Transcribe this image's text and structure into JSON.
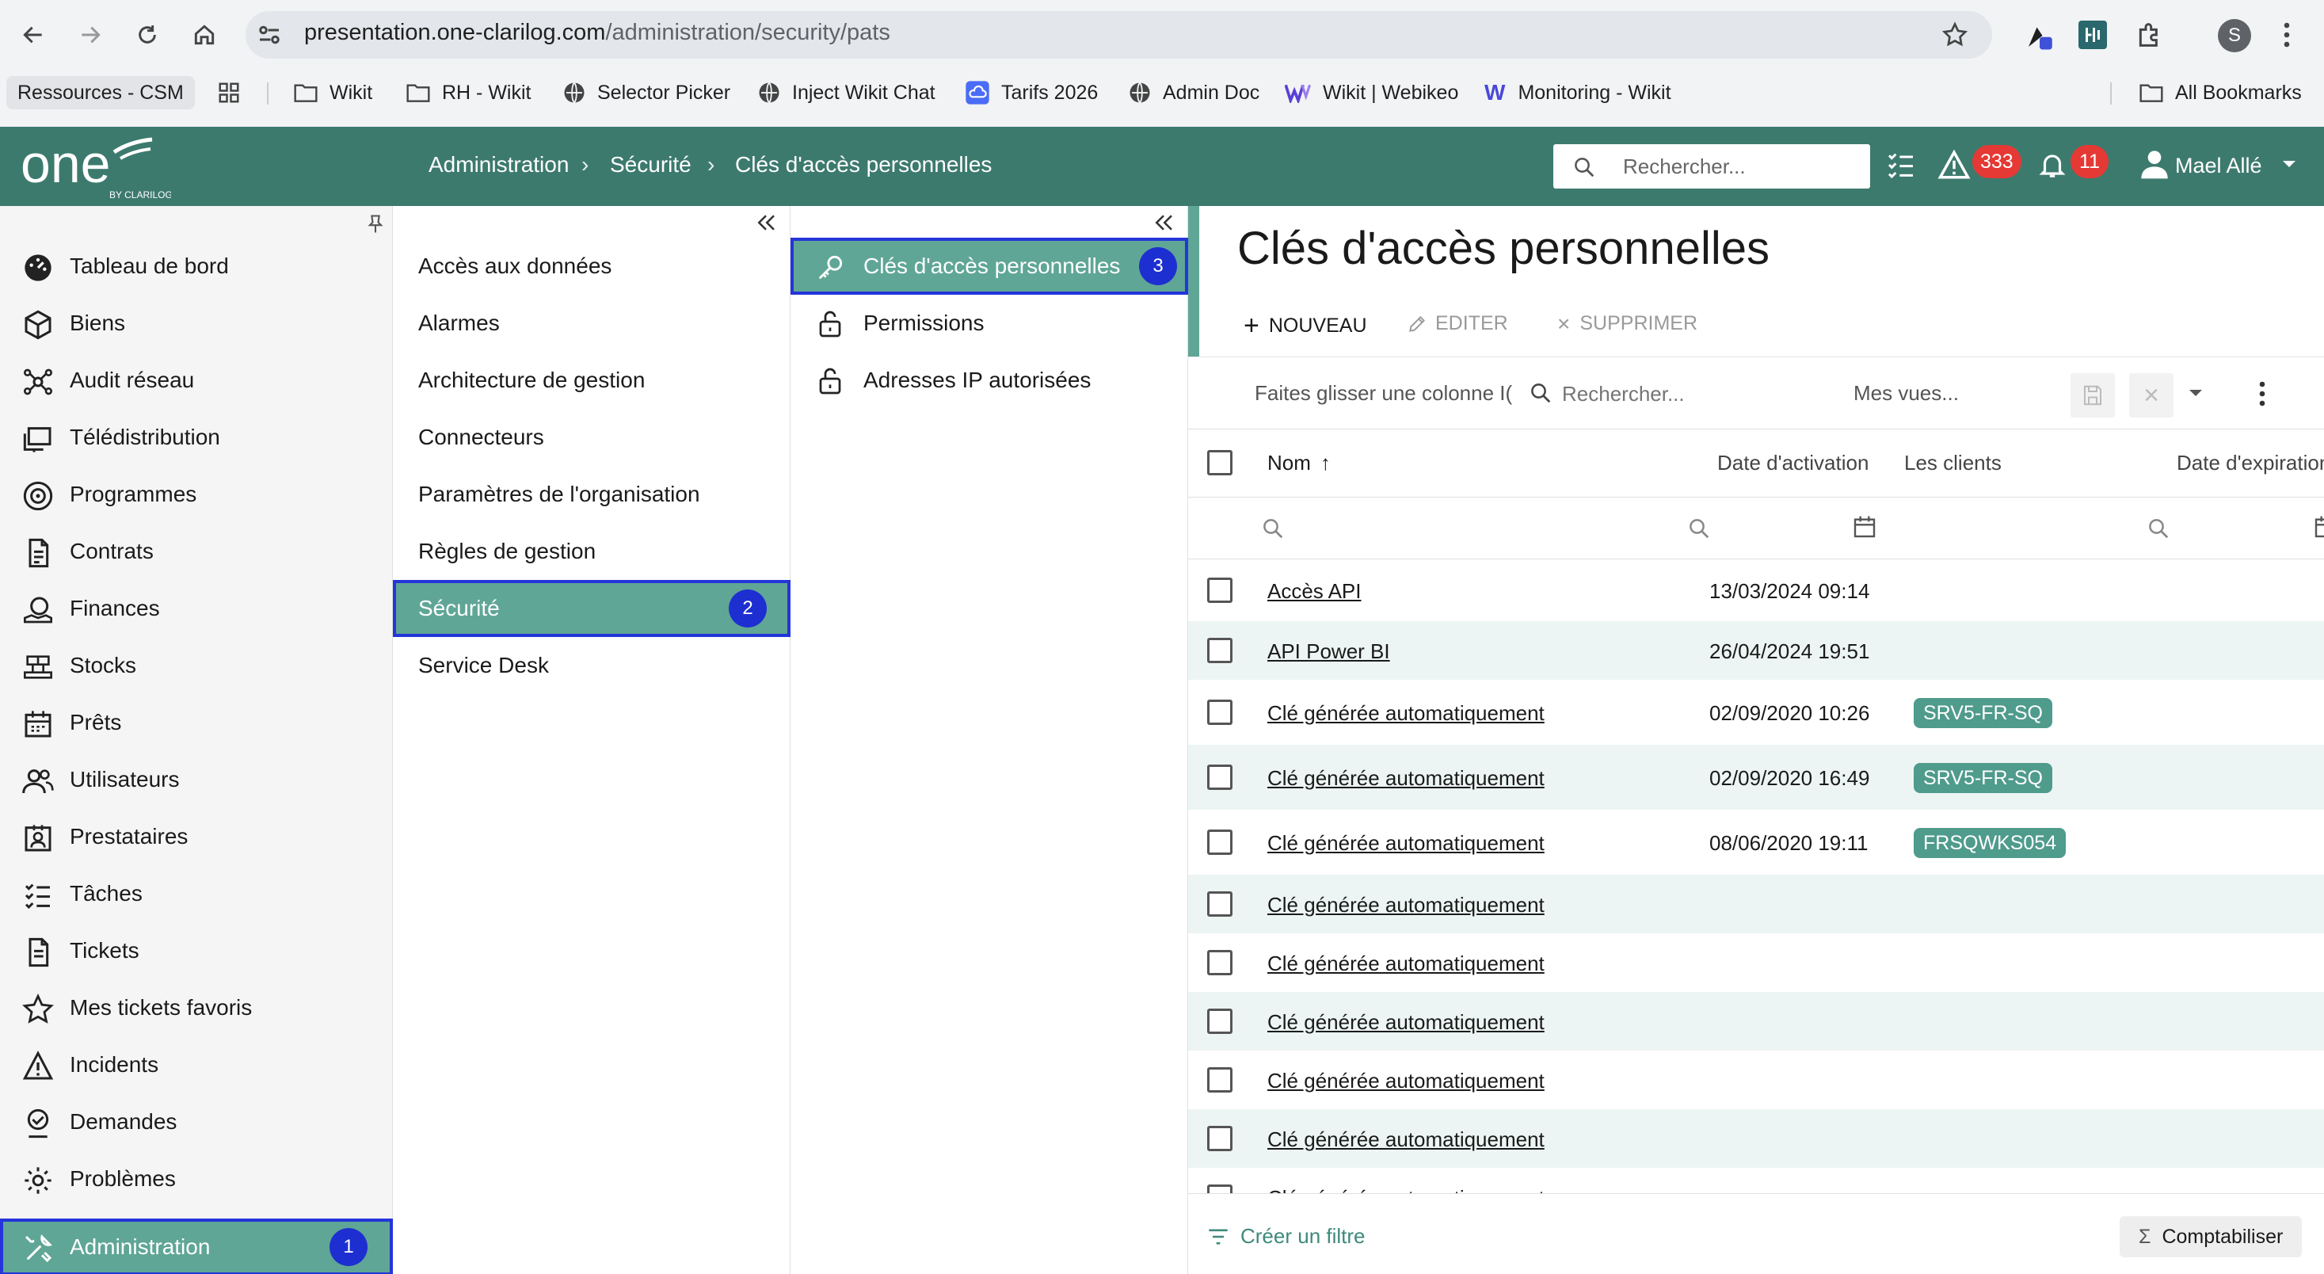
{
  "browser": {
    "url_host": "presentation.one-clarilog.com",
    "url_path": "/administration/security/pats",
    "avatar_letter": "S",
    "bookmarks": [
      {
        "label": "Ressources - CSM",
        "icon": "none"
      },
      {
        "label": "Wikit",
        "icon": "folder-icon"
      },
      {
        "label": "RH - Wikit",
        "icon": "folder-icon"
      },
      {
        "label": "Selector Picker",
        "icon": "globe-icon"
      },
      {
        "label": "Inject Wikit Chat",
        "icon": "globe-icon"
      },
      {
        "label": "Tarifs 2026",
        "icon": "cloud-icon"
      },
      {
        "label": "Admin Doc",
        "icon": "globe-icon"
      },
      {
        "label": "Wikit | Webikeo",
        "icon": "w-logo-icon"
      },
      {
        "label": "Monitoring - Wikit",
        "icon": "w-letter-icon"
      }
    ],
    "all_bookmarks": "All Bookmarks"
  },
  "header": {
    "breadcrumb": [
      "Administration",
      "Sécurité",
      "Clés d'accès personnelles"
    ],
    "search_placeholder": "Rechercher...",
    "alerts_count": "333",
    "notifications_count": "11",
    "user_name": "Mael Allé",
    "colors": {
      "header_bg": "#3d7a6e",
      "badge_red": "#e53935",
      "accent": "#5fa696",
      "highlight_outline": "#2435d9"
    }
  },
  "nav": {
    "items": [
      {
        "label": "Tableau de bord",
        "icon": "dashboard-icon"
      },
      {
        "label": "Biens",
        "icon": "box-icon"
      },
      {
        "label": "Audit réseau",
        "icon": "network-icon"
      },
      {
        "label": "Télédistribution",
        "icon": "deploy-icon"
      },
      {
        "label": "Programmes",
        "icon": "disc-icon"
      },
      {
        "label": "Contrats",
        "icon": "contract-icon"
      },
      {
        "label": "Finances",
        "icon": "finance-icon"
      },
      {
        "label": "Stocks",
        "icon": "stock-icon"
      },
      {
        "label": "Prêts",
        "icon": "calendar-icon"
      },
      {
        "label": "Utilisateurs",
        "icon": "users-icon"
      },
      {
        "label": "Prestataires",
        "icon": "provider-icon"
      },
      {
        "label": "Tâches",
        "icon": "tasks-icon"
      },
      {
        "label": "Tickets",
        "icon": "ticket-icon"
      },
      {
        "label": "Mes tickets favoris",
        "icon": "star-icon"
      },
      {
        "label": "Incidents",
        "icon": "warning-icon"
      },
      {
        "label": "Demandes",
        "icon": "request-icon"
      },
      {
        "label": "Problèmes",
        "icon": "gear-icon"
      }
    ],
    "active": {
      "label": "Administration",
      "badge": "1",
      "icon": "tools-icon"
    }
  },
  "subnav": {
    "items": [
      "Accès aux données",
      "Alarmes",
      "Architecture de gestion",
      "Connecteurs",
      "Paramètres de l'organisation",
      "Règles de gestion"
    ],
    "active": {
      "label": "Sécurité",
      "badge": "2"
    },
    "after": [
      "Service Desk"
    ]
  },
  "subnav2": {
    "active": {
      "label": "Clés d'accès personnelles",
      "badge": "3",
      "icon": "key-icon"
    },
    "items": [
      {
        "label": "Permissions",
        "icon": "lock-icon"
      },
      {
        "label": "Adresses IP autorisées",
        "icon": "lock-icon"
      }
    ]
  },
  "main": {
    "title": "Clés d'accès personnelles",
    "toolbar": {
      "new": "NOUVEAU",
      "edit": "EDITER",
      "delete": "SUPPRIMER"
    },
    "grid_toolbar": {
      "group_hint": "Faites glisser une colonne I(",
      "search_placeholder": "Rechercher...",
      "views": "Mes vues..."
    },
    "columns": {
      "name": "Nom",
      "activation": "Date d'activation",
      "clients": "Les clients",
      "expiration": "Date d'expiration"
    },
    "rows": [
      {
        "name": "Accès API",
        "date": "13/03/2024 09:14",
        "client": ""
      },
      {
        "name": "API Power BI",
        "date": "26/04/2024 19:51",
        "client": ""
      },
      {
        "name": "Clé générée automatiquement",
        "date": "02/09/2020 10:26",
        "client": "SRV5-FR-SQ"
      },
      {
        "name": "Clé générée automatiquement",
        "date": "02/09/2020 16:49",
        "client": "SRV5-FR-SQ"
      },
      {
        "name": "Clé générée automatiquement",
        "date": "08/06/2020 19:11",
        "client": "FRSQWKS054"
      },
      {
        "name": "Clé générée automatiquement",
        "date": "",
        "client": ""
      },
      {
        "name": "Clé générée automatiquement",
        "date": "",
        "client": ""
      },
      {
        "name": "Clé générée automatiquement",
        "date": "",
        "client": ""
      },
      {
        "name": "Clé générée automatiquement",
        "date": "",
        "client": ""
      },
      {
        "name": "Clé générée automatiquement",
        "date": "",
        "client": ""
      },
      {
        "name": "Clé générée automatiquement",
        "date": "",
        "client": ""
      }
    ],
    "footer": {
      "filter": "Créer un filtre",
      "count": "Comptabiliser"
    }
  }
}
